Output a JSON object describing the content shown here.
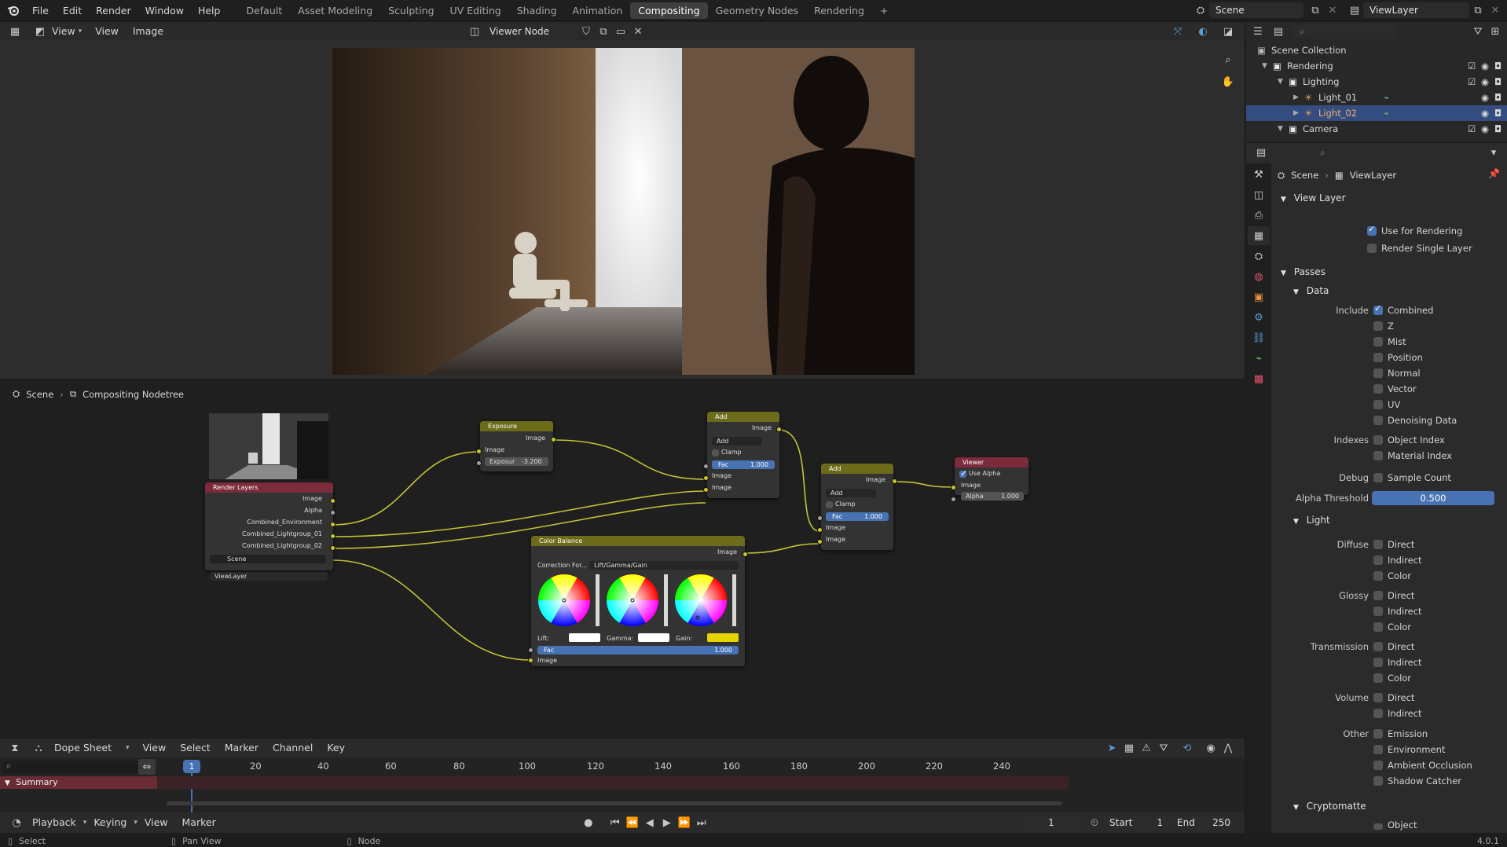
{
  "topbar": {
    "menus": [
      "File",
      "Edit",
      "Render",
      "Window",
      "Help"
    ],
    "workspaces": [
      "Default",
      "Asset Modeling",
      "Sculpting",
      "UV Editing",
      "Shading",
      "Animation",
      "Compositing",
      "Geometry Nodes",
      "Rendering"
    ],
    "active_workspace": "Compositing",
    "add_tab": "+",
    "scene": "Scene",
    "view_layer": "ViewLayer"
  },
  "image_editor": {
    "menus": [
      "View",
      "View",
      "Image"
    ],
    "image_name": "Viewer Node"
  },
  "node_editor": {
    "breadcrumb": [
      "Scene",
      "Compositing Nodetree"
    ],
    "nodes": {
      "render_layers": {
        "title": "Render Layers",
        "outputs": [
          "Image",
          "Alpha",
          "Combined_Environment",
          "Combined_Lightgroup_01",
          "Combined_Lightgroup_02"
        ],
        "scene": "Scene",
        "view_layer": "ViewLayer"
      },
      "exposure": {
        "title": "Exposure",
        "output": "Image",
        "input": "Image",
        "exposure_label": "Exposur",
        "exposure_value": "-3.200"
      },
      "add1": {
        "title": "Add",
        "output": "Image",
        "blend": "Add",
        "clamp": "Clamp",
        "fac_label": "Fac",
        "fac": "1.000",
        "in1": "Image",
        "in2": "Image"
      },
      "add2": {
        "title": "Add",
        "output": "Image",
        "blend": "Add",
        "clamp": "Clamp",
        "fac_label": "Fac",
        "fac": "1.000",
        "in1": "Image",
        "in2": "Image"
      },
      "viewer": {
        "title": "Viewer",
        "use_alpha": "Use Alpha",
        "input": "Image",
        "alpha_label": "Alpha",
        "alpha": "1.000"
      },
      "color_balance": {
        "title": "Color Balance",
        "output": "Image",
        "correction_label": "Correction For...",
        "correction": "Lift/Gamma/Gain",
        "lift": "Lift:",
        "gamma": "Gamma:",
        "gain": "Gain:",
        "fac_label": "Fac",
        "fac": "1.000",
        "input": "Image"
      }
    }
  },
  "dope_sheet": {
    "mode": "Dope Sheet",
    "menus": [
      "View",
      "Select",
      "Marker",
      "Channel",
      "Key"
    ],
    "current_frame": "1",
    "ruler": [
      "20",
      "40",
      "60",
      "80",
      "100",
      "120",
      "140",
      "160",
      "180",
      "200",
      "220",
      "240"
    ],
    "summary": "Summary"
  },
  "playback": {
    "menus": [
      "Playback",
      "Keying",
      "View",
      "Marker"
    ],
    "frame": "1",
    "start_label": "Start",
    "start": "1",
    "end_label": "End",
    "end": "250"
  },
  "statusbar": {
    "items": [
      "Select",
      "Pan View",
      "Node"
    ],
    "version": "4.0.1"
  },
  "outliner": {
    "rows": [
      {
        "label": "Scene Collection",
        "level": 0
      },
      {
        "label": "Rendering",
        "level": 1
      },
      {
        "label": "Lighting",
        "level": 2
      },
      {
        "label": "Light_01",
        "level": 3
      },
      {
        "label": "Light_02",
        "level": 3,
        "selected": true
      },
      {
        "label": "Camera",
        "level": 2
      }
    ]
  },
  "properties": {
    "breadcrumb": [
      "Scene",
      "ViewLayer"
    ],
    "view_layer_panel": "View Layer",
    "use_for_rendering": "Use for Rendering",
    "render_single_layer": "Render Single Layer",
    "passes": "Passes",
    "data": "Data",
    "include_label": "Include",
    "include": [
      "Combined",
      "Z",
      "Mist",
      "Position",
      "Normal",
      "Vector",
      "UV",
      "Denoising Data"
    ],
    "indexes_label": "Indexes",
    "indexes": [
      "Object Index",
      "Material Index"
    ],
    "debug_label": "Debug",
    "debug": "Sample Count",
    "alpha_threshold_label": "Alpha Threshold",
    "alpha_threshold": "0.500",
    "light": "Light",
    "diffuse_label": "Diffuse",
    "glossy_label": "Glossy",
    "transmission_label": "Transmission",
    "volume_label": "Volume",
    "direct": "Direct",
    "indirect": "Indirect",
    "color": "Color",
    "other_label": "Other",
    "other": [
      "Emission",
      "Environment",
      "Ambient Occlusion",
      "Shadow Catcher"
    ],
    "cryptomatte": "Cryptomatte",
    "crypto_object": "Object"
  },
  "colors": {
    "accent": "#4772b3",
    "socket": "#c7c729",
    "render_layers_header": "#7c2b3b",
    "filter_header": "#6b6b1a"
  }
}
